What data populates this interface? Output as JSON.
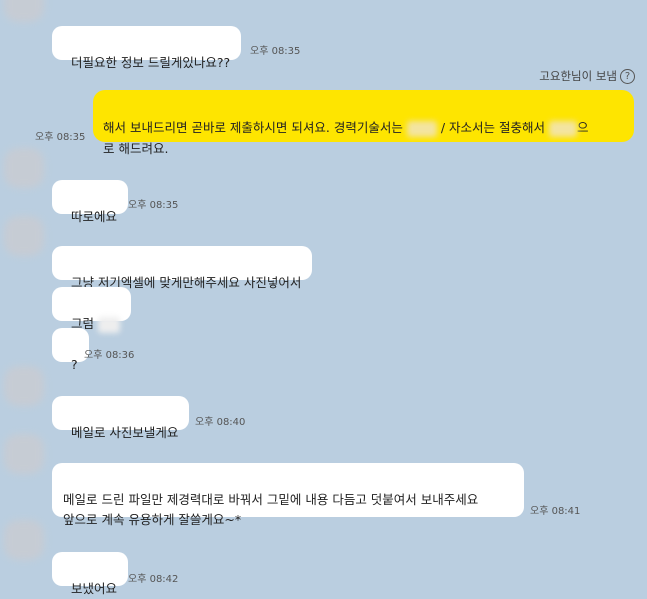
{
  "messages": [
    {
      "text": "더필요한 정보 드릴게있나요??",
      "time": "오후 08:35"
    },
    {
      "text_a": "해서 보내드리면 곧바로 제출하시면 되셔요. 경력기술서는",
      "text_b": "/ 자소서는 절충해서",
      "text_c": "으",
      "text_d": "로 해드려요.",
      "time": "오후 08:35"
    },
    {
      "text": "따로에요",
      "time": "오후 08:35"
    },
    {
      "text": "그냥 저기엑셀에 맞게만해주세요 사진넣어서"
    },
    {
      "text": "그럼"
    },
    {
      "text": "?",
      "time": "오후 08:36"
    },
    {
      "text": "메일로 사진보낼게요",
      "time": "오후 08:40"
    },
    {
      "text_line1": "메일로 드린 파일만 제경력대로 바꿔서 그밑에 내용 다듬고 덧붙여서 보내주세요",
      "text_line2": "앞으로 계속 유용하게 잘쓸게요~*",
      "time": "오후 08:41"
    },
    {
      "text": "보냈어요",
      "time": "오후 08:42"
    }
  ],
  "read_status": "고요한님이 보냄",
  "help_icon": "question-circle-icon",
  "colors": {
    "background": "#bacee0",
    "my_bubble": "#fee500",
    "their_bubble": "#ffffff"
  }
}
